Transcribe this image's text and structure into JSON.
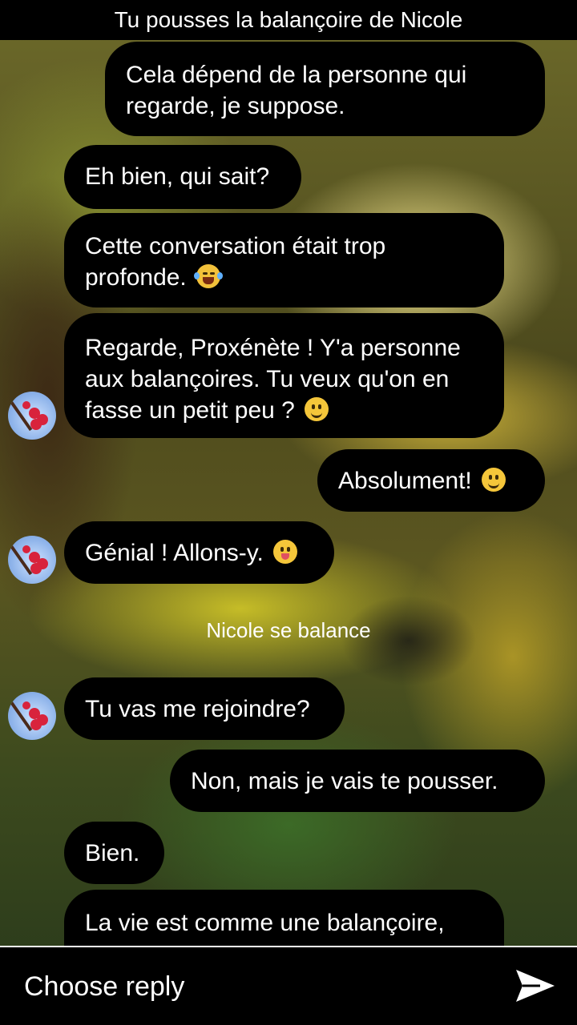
{
  "header": {
    "title": "Tu pousses la balançoire de Nicole"
  },
  "messages": [
    {
      "text": "Cela dépend de la personne qui regarde, je suppose.",
      "side": "right"
    },
    {
      "text": "Eh bien, qui sait?",
      "side": "left"
    },
    {
      "text": "Cette conversation était trop profonde.",
      "emoji": "laughing-tears-emoji",
      "side": "left"
    },
    {
      "text": "Regarde, Proxénète ! Y'a personne aux balançoires. Tu veux qu'on en fasse un petit peu ?",
      "emoji": "smile-emoji",
      "side": "left"
    },
    {
      "text": "Absolument!",
      "emoji": "smile-emoji",
      "side": "right"
    },
    {
      "text": "Génial ! Allons-y.",
      "emoji": "tongue-emoji",
      "side": "left"
    },
    {
      "text": "Tu vas me rejoindre?",
      "side": "left"
    },
    {
      "text": "Non, mais je vais te pousser.",
      "side": "right"
    },
    {
      "text": "Bien.",
      "side": "left"
    },
    {
      "text": "La vie est comme une balançoire,",
      "side": "left"
    }
  ],
  "system_message": "Nicole se balance",
  "footer": {
    "reply_label": "Choose reply",
    "send_icon": "send-icon"
  },
  "avatar": {
    "name": "nicole-avatar",
    "colors": {
      "sky": "#8fb4ea",
      "flower": "#d8233c"
    }
  }
}
